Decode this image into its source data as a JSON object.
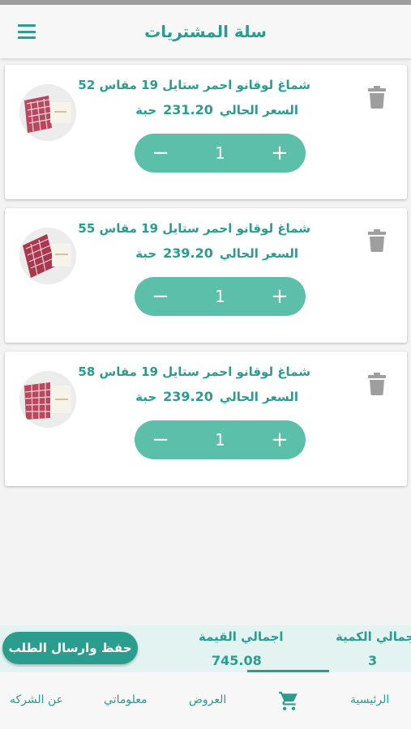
{
  "header": {
    "title": "سلة المشتريات",
    "menu_icon": "hamburger-menu-icon"
  },
  "cart": {
    "items": [
      {
        "title": "شماغ لوقانو احمر ستايل 19 مقاس 52",
        "price_label": "السعر الحالي",
        "price": "231.20",
        "unit": "حبة",
        "quantity": "1"
      },
      {
        "title": "شماغ لوقانو احمر ستايل 19 مقاس 55",
        "price_label": "السعر الحالي",
        "price": "239.20",
        "unit": "حبة",
        "quantity": "1"
      },
      {
        "title": "شماغ لوقانو احمر ستايل 19 مقاس 58",
        "price_label": "السعر الحالي",
        "price": "239.20",
        "unit": "حبة",
        "quantity": "1"
      }
    ],
    "minus_symbol": "−",
    "plus_symbol": "+"
  },
  "summary": {
    "submit_label": "حفظ وارسال الطلب",
    "total_value_label": "اجمالي القيمة",
    "total_value": "745.08",
    "total_qty_label": "اجمالي الكمية",
    "total_qty": "3"
  },
  "nav": {
    "home": "الرئيسية",
    "cart_icon": "shopping-cart-icon",
    "offers": "العروض",
    "my_info": "معلوماتي",
    "about": "عن الشركه"
  },
  "colors": {
    "accent": "#2a9d8f",
    "stepper": "#5cbfa9",
    "summary_bg": "#e3f3f2",
    "delete_icon": "#9e9e9e"
  }
}
